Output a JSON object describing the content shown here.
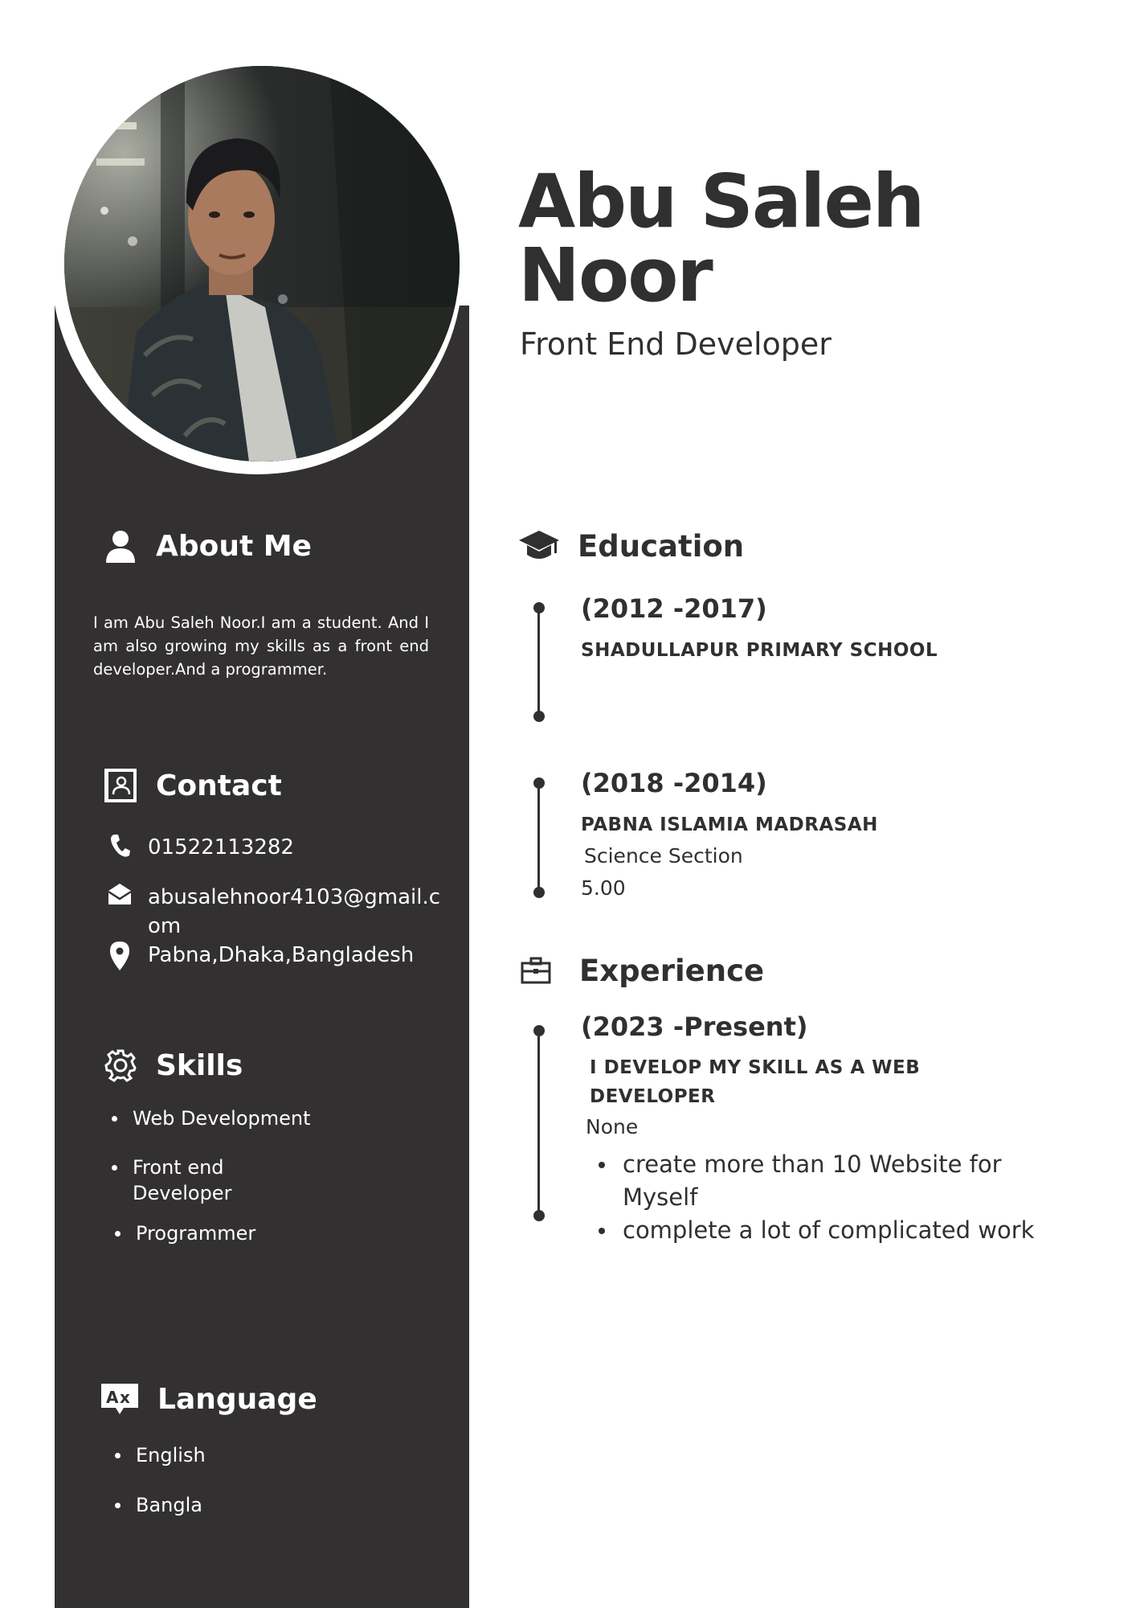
{
  "profile": {
    "name": "Abu Saleh Noor",
    "title": "Front End Developer"
  },
  "about": {
    "heading": "About Me",
    "icon": "user-icon",
    "text": "I am Abu Saleh Noor.I am a student. And I am also growing my skills as a front end developer.And a programmer."
  },
  "contact": {
    "heading": "Contact",
    "icon": "contact-book-icon",
    "phone": "01522113282",
    "email": "abusalehnoor4103@gmail.com",
    "address": "Pabna,Dhaka,Bangladesh"
  },
  "skills": {
    "heading": "Skills",
    "icon": "gear-icon",
    "items": [
      "Web Development",
      "Front end Developer",
      "Programmer"
    ]
  },
  "language": {
    "heading": "Language",
    "icon": "translate-icon",
    "items": [
      "English",
      "Bangla"
    ]
  },
  "education": {
    "heading": "Education",
    "icon": "graduation-cap-icon",
    "entries": [
      {
        "years": "(2012 -2017)",
        "institution": "SHADULLAPUR PRIMARY SCHOOL"
      },
      {
        "years": "(2018 -2014)",
        "institution": "PABNA ISLAMIA MADRASAH",
        "section": "Science Section",
        "result": "5.00"
      }
    ]
  },
  "experience": {
    "heading": "Experience",
    "icon": "briefcase-icon",
    "entries": [
      {
        "years": "(2023 -Present)",
        "role": "I DEVELOP MY SKILL AS A WEB DEVELOPER",
        "company": "None",
        "points": [
          "create more than 10  Website  for Myself",
          "complete a lot of complicated work"
        ]
      }
    ]
  },
  "colors": {
    "sidebar": "#323031",
    "text": "#303030",
    "white": "#ffffff"
  }
}
